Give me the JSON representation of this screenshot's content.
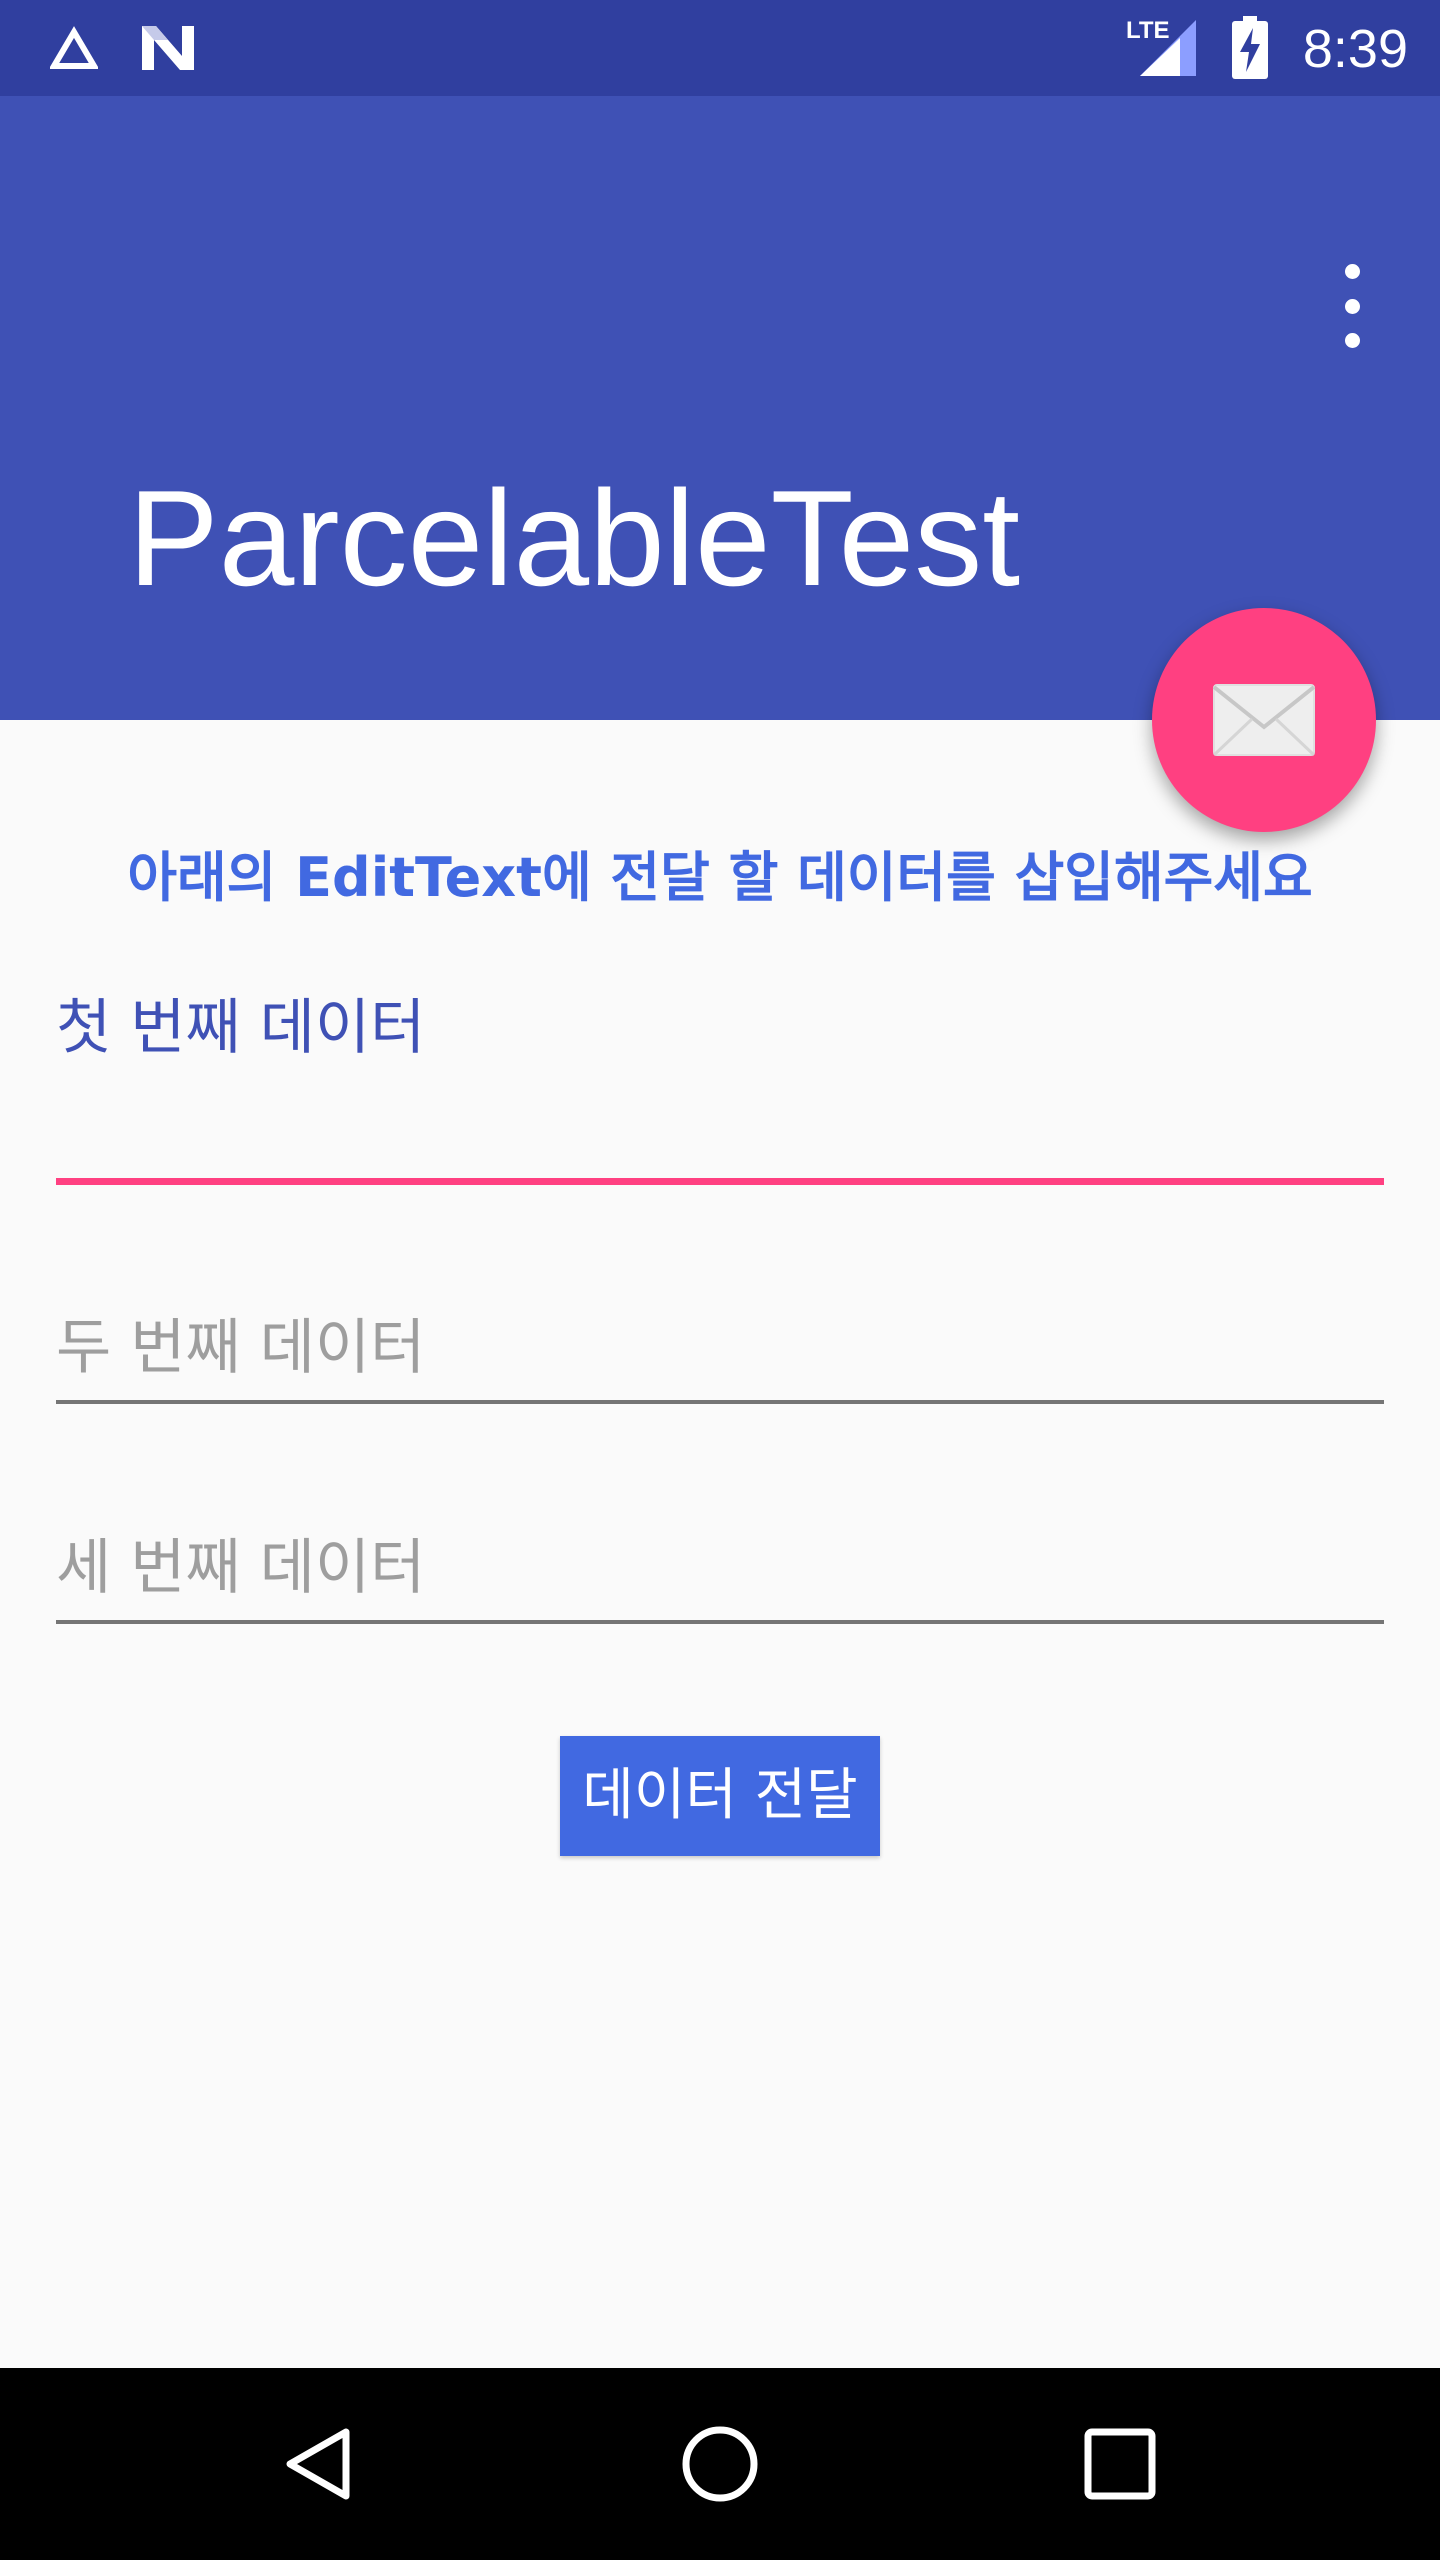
{
  "status_bar": {
    "time": "8:39",
    "network_label": "LTE",
    "icons": [
      "alert-triangle-icon",
      "n-notification-icon",
      "lte-signal-icon",
      "battery-charging-icon"
    ]
  },
  "app_bar": {
    "title": "ParcelableTest",
    "overflow_icon": "more-vert-icon"
  },
  "fab": {
    "icon": "envelope-icon"
  },
  "content": {
    "instruction": "아래의 EditText에 전달 할 데이터를 삽입해주세요",
    "fields": [
      {
        "label": "첫 번째 데이터",
        "value": "",
        "focused": true
      },
      {
        "hint": "두 번째 데이터",
        "value": ""
      },
      {
        "hint": "세 번째 데이터",
        "value": ""
      }
    ],
    "submit_label": "데이터 전달"
  },
  "nav_bar": {
    "buttons": [
      "back-icon",
      "home-icon",
      "recents-icon"
    ]
  },
  "colors": {
    "status_bar": "#303f9f",
    "primary": "#3f51b5",
    "accent": "#ff4081",
    "instruction_text": "#4169e1",
    "button": "#4169e1",
    "background": "#fafafa"
  }
}
